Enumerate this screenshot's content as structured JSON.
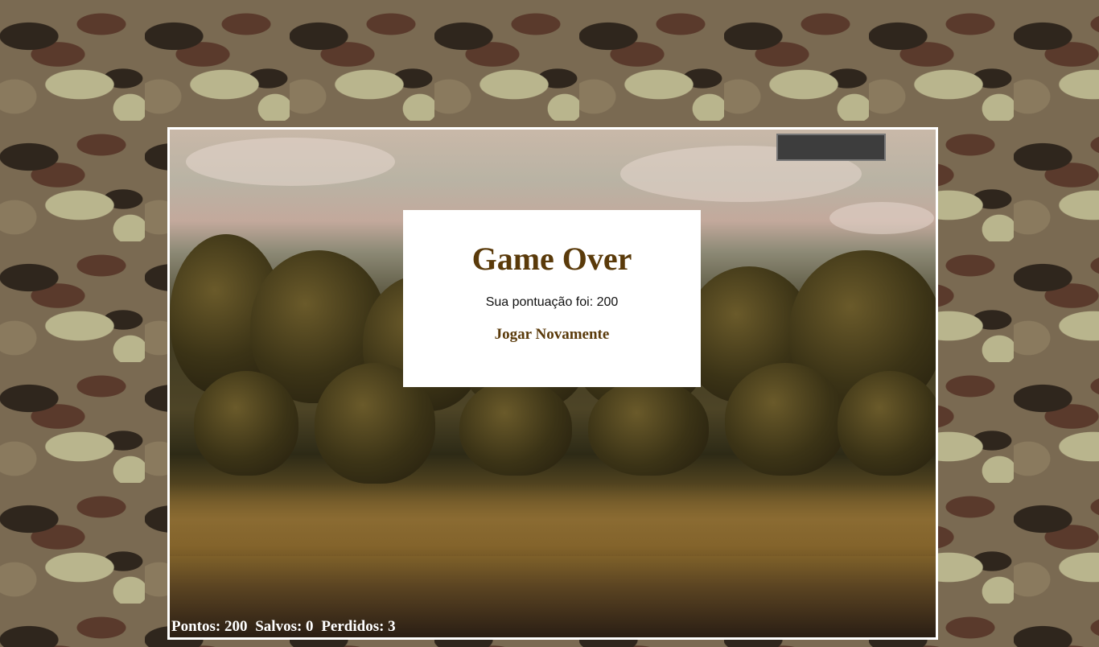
{
  "game": {
    "modal": {
      "title": "Game Over",
      "score_text": "Sua pontuação foi: 200",
      "button_label": "Jogar Novamente"
    },
    "status": {
      "pontos": "Pontos: 200",
      "salvos": "Salvos: 0",
      "perdidos": "Perdidos: 3"
    }
  },
  "colors": {
    "modal_title": "#5a3a0a",
    "frame_border": "#ffffff",
    "hud_box": "#3d3d3d"
  }
}
